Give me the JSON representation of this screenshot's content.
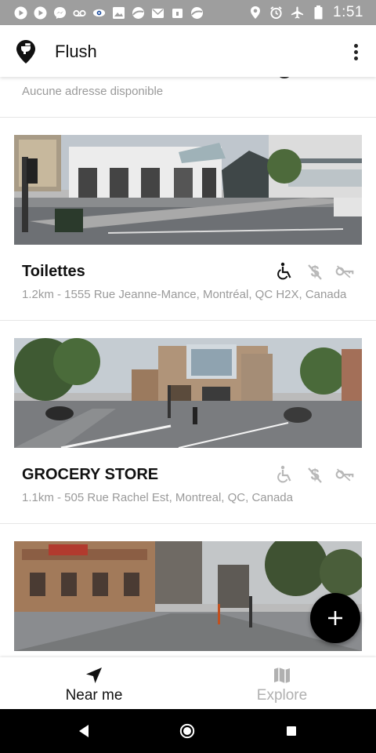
{
  "status_bar": {
    "time": "1:51",
    "left_icons": [
      "youtube-icon",
      "youtube-icon",
      "messenger-icon",
      "voicemail-icon",
      "eye-icon",
      "image-icon",
      "globe-icon",
      "mail-icon",
      "lock-icon",
      "globe-icon"
    ],
    "right_icons": [
      "location-icon",
      "alarm-icon",
      "airplane-icon",
      "battery-icon"
    ]
  },
  "app_bar": {
    "title": "Flush"
  },
  "list": {
    "partial_item": {
      "address": "Aucune adresse disponible"
    },
    "cards": [
      {
        "name": "Toilettes",
        "address": "1.2km - 1555 Rue Jeanne-Mance, Montréal, QC H2X, Canada",
        "amenities": {
          "accessible": "active",
          "free": "inactive",
          "key_required": "inactive"
        }
      },
      {
        "name": "GROCERY STORE",
        "address": "1.1km - 505 Rue Rachel Est, Montreal, QC, Canada",
        "amenities": {
          "accessible": "inactive",
          "free": "inactive",
          "key_required": "inactive"
        }
      },
      {
        "name": "",
        "address": ""
      }
    ]
  },
  "fab": {
    "icon": "plus-icon"
  },
  "bottom_nav": {
    "tabs": [
      {
        "label": "Near me",
        "icon": "navigation-arrow-icon",
        "state": "active"
      },
      {
        "label": "Explore",
        "icon": "map-icon",
        "state": "inactive"
      }
    ]
  },
  "colors": {
    "status_bar": "#9e9e9e",
    "primary_text": "#111111",
    "secondary_text": "#9a9a9a",
    "inactive_icon": "#b0b0b0",
    "fab": "#000000",
    "system_nav": "#000000"
  }
}
